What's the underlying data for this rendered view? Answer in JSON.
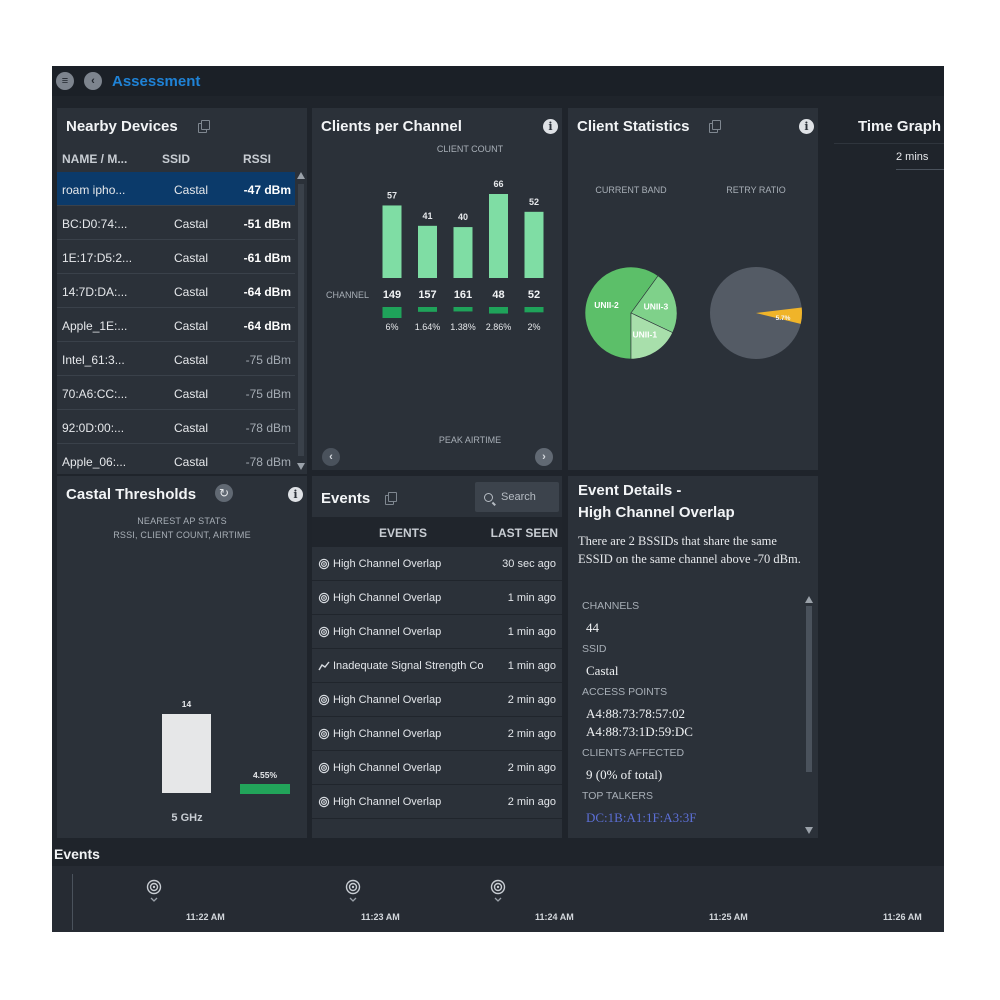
{
  "app": {
    "title": "Assessment"
  },
  "nearby": {
    "title": "Nearby Devices",
    "headers": {
      "name": "NAME / M...",
      "ssid": "SSID",
      "rssi": "RSSI"
    },
    "rows": [
      {
        "name": "roam ipho...",
        "ssid": "Castal",
        "rssi": "-47 dBm",
        "strong": true,
        "selected": true
      },
      {
        "name": "BC:D0:74:...",
        "ssid": "Castal",
        "rssi": "-51 dBm",
        "strong": true
      },
      {
        "name": "1E:17:D5:2...",
        "ssid": "Castal",
        "rssi": "-61 dBm",
        "strong": true
      },
      {
        "name": "14:7D:DA:...",
        "ssid": "Castal",
        "rssi": "-64 dBm",
        "strong": true
      },
      {
        "name": "Apple_1E:...",
        "ssid": "Castal",
        "rssi": "-64 dBm",
        "strong": true
      },
      {
        "name": "Intel_61:3...",
        "ssid": "Castal",
        "rssi": "-75 dBm",
        "strong": false
      },
      {
        "name": "70:A6:CC:...",
        "ssid": "Castal",
        "rssi": "-75 dBm",
        "strong": false
      },
      {
        "name": "92:0D:00:...",
        "ssid": "Castal",
        "rssi": "-78 dBm",
        "strong": false
      },
      {
        "name": "Apple_06:...",
        "ssid": "Castal",
        "rssi": "-78 dBm",
        "strong": false
      }
    ]
  },
  "cpc": {
    "title": "Clients per Channel",
    "client_count_label": "CLIENT COUNT",
    "channel_label": "CHANNEL",
    "peak_airtime_label": "PEAK AIRTIME",
    "bar_color": "#7fdda4",
    "airtime_color": "#1fa35a"
  },
  "chart_data": [
    {
      "type": "bar",
      "categories": [
        "149",
        "157",
        "161",
        "48",
        "52"
      ],
      "values": [
        57,
        41,
        40,
        66,
        52
      ],
      "title": "",
      "xlabel": "CHANNEL",
      "ylabel": "CLIENT COUNT",
      "airtime": [
        "6%",
        "1.64%",
        "1.38%",
        "2.86%",
        "2%"
      ],
      "airtime_values": [
        6,
        1.64,
        1.38,
        2.86,
        2
      ]
    },
    {
      "type": "pie",
      "title": "CURRENT BAND",
      "labels": [
        "UNII-2",
        "UNII-3",
        "UNII-1"
      ],
      "values": [
        60,
        22,
        18
      ],
      "colors": [
        "#5cbf69",
        "#7fd18a",
        "#a8dfab"
      ]
    },
    {
      "type": "pie",
      "title": "RETRY RATIO",
      "labels": [
        "5.7%",
        ""
      ],
      "values": [
        5.7,
        94.3
      ],
      "colors": [
        "#f0b429",
        "#545b65"
      ]
    },
    {
      "type": "bar",
      "title": "",
      "subtitle": "NEAREST AP STATS",
      "subtitle2": "RSSI, CLIENT COUNT, AIRTIME",
      "categories": [
        "5 GHz"
      ],
      "client_count": 14,
      "airtime": "4.55%",
      "airtime_value": 4.55,
      "colors": {
        "count": "#e6e7e8",
        "airtime": "#22a45a"
      }
    }
  ],
  "cstats": {
    "title": "Client Statistics",
    "band_label": "CURRENT BAND",
    "retry_label": "RETRY RATIO",
    "band_pie": [
      {
        "label": "UNII-2",
        "value": 60,
        "color": "#5cbf69"
      },
      {
        "label": "UNII-3",
        "value": 22,
        "color": "#7fd18a"
      },
      {
        "label": "UNII-1",
        "value": 18,
        "color": "#a8dfab"
      }
    ],
    "retry_pct_label": "5.7%",
    "retry_value": 5.7,
    "retry_color": "#f0b429",
    "retry_bg": "#545b65"
  },
  "tgraph": {
    "title": "Time Graph",
    "range": "2 mins"
  },
  "thresholds": {
    "title": "Castal Thresholds",
    "subtitle": "NEAREST AP STATS",
    "subtitle2": "RSSI, CLIENT COUNT, AIRTIME",
    "count_label": "14",
    "airtime_label": "4.55%",
    "band_label": "5 GHz"
  },
  "events": {
    "title": "Events",
    "search_placeholder": "Search",
    "headers": {
      "events": "EVENTS",
      "last_seen": "LAST SEEN"
    },
    "rows": [
      {
        "icon": "wifi",
        "name": "High Channel Overlap",
        "time": "30 sec ago"
      },
      {
        "icon": "wifi",
        "name": "High Channel Overlap",
        "time": "1 min ago"
      },
      {
        "icon": "wifi",
        "name": "High Channel Overlap",
        "time": "1 min ago"
      },
      {
        "icon": "signal",
        "name": "Inadequate Signal Strength Co",
        "time": "1 min ago"
      },
      {
        "icon": "wifi",
        "name": "High Channel Overlap",
        "time": "2 min ago"
      },
      {
        "icon": "wifi",
        "name": "High Channel Overlap",
        "time": "2 min ago"
      },
      {
        "icon": "wifi",
        "name": "High Channel Overlap",
        "time": "2 min ago"
      },
      {
        "icon": "wifi",
        "name": "High Channel Overlap",
        "time": "2 min ago"
      }
    ]
  },
  "details": {
    "title_line1": "Event Details -",
    "title_line2": "High Channel Overlap",
    "description": "There are 2 BSSIDs that share the same ESSID on the same channel above -70 dBm.",
    "channels_label": "CHANNELS",
    "channels_value": "44",
    "ssid_label": "SSID",
    "ssid_value": "Castal",
    "aps_label": "ACCESS POINTS",
    "ap1": "A4:88:73:78:57:02",
    "ap2": "A4:88:73:1D:59:DC",
    "clients_label": "CLIENTS AFFECTED",
    "clients_value": "9 (0% of total)",
    "talkers_label": "TOP TALKERS",
    "talker1": "DC:1B:A1:1F:A3:3F"
  },
  "timeline": {
    "title": "Events",
    "times": [
      "11:22 AM",
      "11:23 AM",
      "11:24 AM",
      "11:25 AM",
      "11:26 AM"
    ]
  }
}
